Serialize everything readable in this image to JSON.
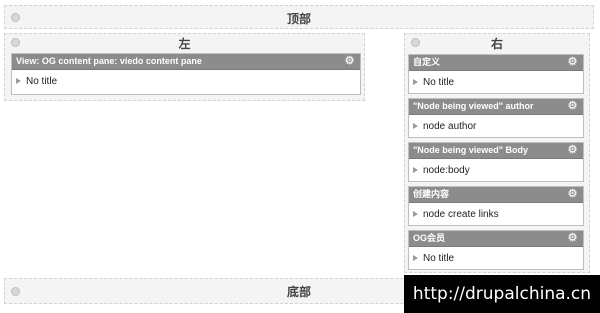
{
  "regions": {
    "top": {
      "title": "顶部"
    },
    "left": {
      "title": "左"
    },
    "right": {
      "title": "右"
    },
    "bottom": {
      "title": "底部"
    }
  },
  "left_panes": [
    {
      "header": "View: OG content pane: viedo content pane",
      "body": "No title"
    }
  ],
  "right_panes": [
    {
      "header": "自定义",
      "body": "No title"
    },
    {
      "header": "\"Node being viewed\" author",
      "body": "node author"
    },
    {
      "header": "\"Node being viewed\" Body",
      "body": "node:body"
    },
    {
      "header": "创建内容",
      "body": "node create links"
    },
    {
      "header": "OG会员",
      "body": "No title"
    }
  ],
  "watermark": "http://drupalchina.cn",
  "icons": {
    "pane_settings": "gear-icon",
    "pane_expand": "triangle-right-icon",
    "region_settings": "circle-icon"
  }
}
